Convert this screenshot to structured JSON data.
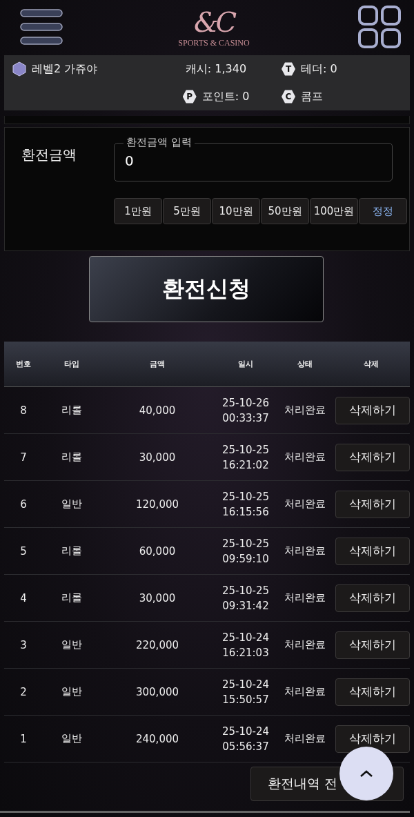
{
  "header": {
    "logo_mark": "&C",
    "logo_text": "SPORTS & CASINO"
  },
  "info_bar": {
    "level": "레벨2 가쥬야",
    "cash": "캐시: 1,340",
    "tether": "테더: 0",
    "points": "포인트: 0",
    "comp": "콤프",
    "tether_badge": "T",
    "points_badge": "P",
    "comp_badge": "C"
  },
  "amount_form": {
    "label": "환전금액",
    "field_label": "환전금액 입력",
    "value": "0",
    "quick_buttons": [
      {
        "label": "1만원",
        "kind": "amount"
      },
      {
        "label": "5만원",
        "kind": "amount"
      },
      {
        "label": "10만원",
        "kind": "amount"
      },
      {
        "label": "50만원",
        "kind": "amount"
      },
      {
        "label": "100만원",
        "kind": "amount"
      },
      {
        "label": "정정",
        "kind": "reset"
      }
    ]
  },
  "submit_button": "환전신청",
  "table": {
    "columns": [
      "번호",
      "타입",
      "금액",
      "일시",
      "상태",
      "삭제"
    ],
    "rows": [
      {
        "no": "8",
        "type": "리롤",
        "amount": "40,000",
        "date": "25-10-26",
        "time": "00:33:37",
        "status": "처리완료",
        "action": "삭제하기"
      },
      {
        "no": "7",
        "type": "리롤",
        "amount": "30,000",
        "date": "25-10-25",
        "time": "16:21:02",
        "status": "처리완료",
        "action": "삭제하기"
      },
      {
        "no": "6",
        "type": "일반",
        "amount": "120,000",
        "date": "25-10-25",
        "time": "16:15:56",
        "status": "처리완료",
        "action": "삭제하기"
      },
      {
        "no": "5",
        "type": "리롤",
        "amount": "60,000",
        "date": "25-10-25",
        "time": "09:59:10",
        "status": "처리완료",
        "action": "삭제하기"
      },
      {
        "no": "4",
        "type": "리롤",
        "amount": "30,000",
        "date": "25-10-25",
        "time": "09:31:42",
        "status": "처리완료",
        "action": "삭제하기"
      },
      {
        "no": "3",
        "type": "일반",
        "amount": "220,000",
        "date": "25-10-24",
        "time": "16:21:03",
        "status": "처리완료",
        "action": "삭제하기"
      },
      {
        "no": "2",
        "type": "일반",
        "amount": "300,000",
        "date": "25-10-24",
        "time": "15:50:57",
        "status": "처리완료",
        "action": "삭제하기"
      },
      {
        "no": "1",
        "type": "일반",
        "amount": "240,000",
        "date": "25-10-24",
        "time": "05:56:37",
        "status": "처리완료",
        "action": "삭제하기"
      }
    ]
  },
  "history_button": "환전내역 전"
}
